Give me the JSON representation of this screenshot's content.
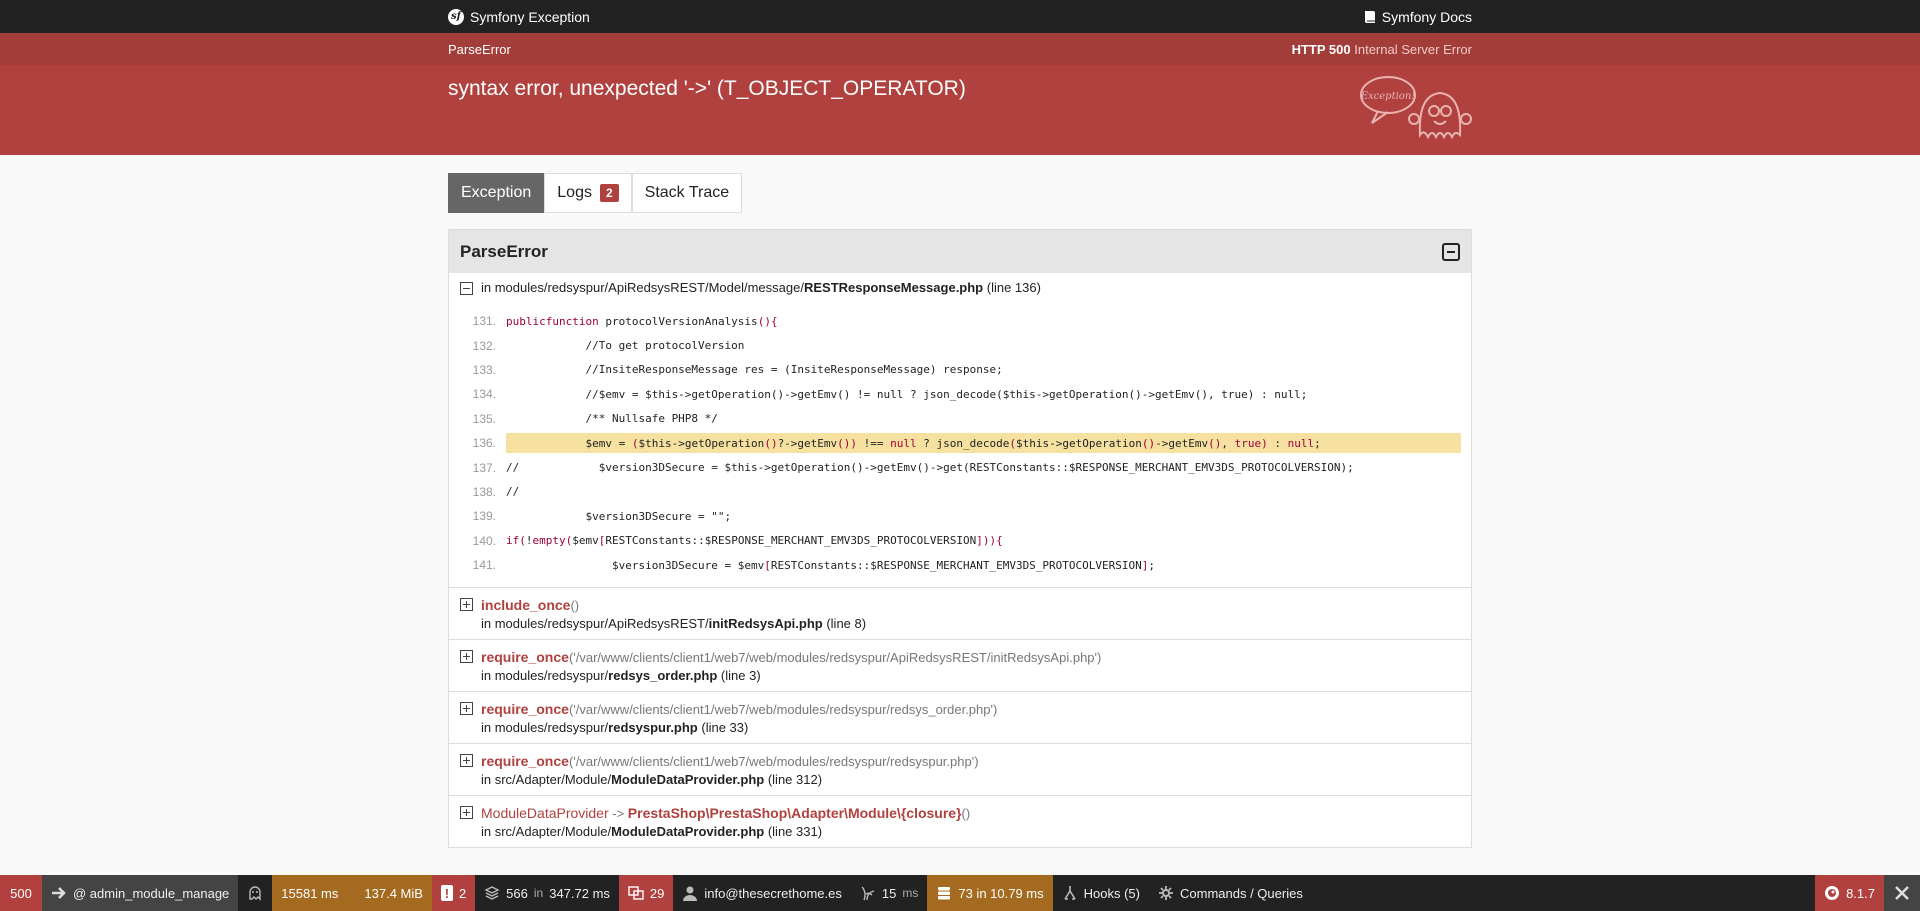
{
  "topbar": {
    "title": "Symfony Exception",
    "docs_label": "Symfony Docs"
  },
  "exception": {
    "class": "ParseError",
    "status_code": "HTTP 500",
    "status_text": "Internal Server Error",
    "message": "syntax error, unexpected '->' (T_OBJECT_OPERATOR)",
    "ghost_text": "Exception!"
  },
  "tabs": {
    "exception": "Exception",
    "logs": "Logs",
    "logs_count": "2",
    "stack_trace": "Stack Trace"
  },
  "panel": {
    "title": "ParseError",
    "location_prefix": "in modules/redsyspur/ApiRedsysREST/Model/message/",
    "location_file": "RESTResponseMessage.php",
    "location_line": "(line 136)"
  },
  "code": [
    {
      "ln": "131.",
      "text": "        public function protocolVersionAnalysis() {"
    },
    {
      "ln": "132.",
      "text": "            //To get protocolVersion"
    },
    {
      "ln": "133.",
      "text": "            //InsiteResponseMessage res = (InsiteResponseMessage) response;"
    },
    {
      "ln": "134.",
      "text": "            //$emv = $this->getOperation()->getEmv() != null ? json_decode($this->getOperation()->getEmv(), true) : null;"
    },
    {
      "ln": "135.",
      "text": "            /** Nullsafe PHP8 */"
    },
    {
      "ln": "136.",
      "text": "            $emv = ($this->getOperation()?->getEmv()) !== null ? json_decode($this->getOperation()->getEmv(), true) : null;"
    },
    {
      "ln": "137.",
      "text": "//            $version3DSecure = $this->getOperation()->getEmv()->get(RESTConstants::$RESPONSE_MERCHANT_EMV3DS_PROTOCOLVERSION);"
    },
    {
      "ln": "138.",
      "text": "//"
    },
    {
      "ln": "139.",
      "text": "            $version3DSecure = \"\";"
    },
    {
      "ln": "140.",
      "text": "            if (!empty($emv[RESTConstants::$RESPONSE_MERCHANT_EMV3DS_PROTOCOLVERSION])) {"
    },
    {
      "ln": "141.",
      "text": "                $version3DSecure = $emv[RESTConstants::$RESPONSE_MERCHANT_EMV3DS_PROTOCOLVERSION];"
    }
  ],
  "traces": [
    {
      "cls": "",
      "fn": "include_once",
      "args": "()",
      "prefix": "in modules/redsyspur/ApiRedsysREST/",
      "file": "initRedsysApi.php",
      "line": "(line 8)"
    },
    {
      "cls": "",
      "fn": "require_once",
      "args": "('/var/www/clients/client1/web7/web/modules/redsyspur/ApiRedsysREST/initRedsysApi.php')",
      "prefix": "in modules/redsyspur/",
      "file": "redsys_order.php",
      "line": "(line 3)"
    },
    {
      "cls": "",
      "fn": "require_once",
      "args": "('/var/www/clients/client1/web7/web/modules/redsyspur/redsys_order.php')",
      "prefix": "in modules/redsyspur/",
      "file": "redsyspur.php",
      "line": "(line 33)"
    },
    {
      "cls": "",
      "fn": "require_once",
      "args": "('/var/www/clients/client1/web7/web/modules/redsyspur/redsyspur.php')",
      "prefix": "in src/Adapter/Module/",
      "file": "ModuleDataProvider.php",
      "line": "(line 312)"
    },
    {
      "cls": "ModuleDataProvider",
      "arrow": " -> ",
      "fn": "PrestaShop\\PrestaShop\\Adapter\\Module\\{closure}",
      "args": "()",
      "prefix": "in src/Adapter/Module/",
      "file": "ModuleDataProvider.php",
      "line": "(line 331)"
    }
  ],
  "toolbar": {
    "status": "500",
    "route": "@ admin_module_manage",
    "time": "15581 ms",
    "memory": "137.4 MiB",
    "errors": "2",
    "cache_count": "566",
    "cache_in": "in",
    "cache_time": "347.72 ms",
    "translations": "29",
    "user": "info@thesecrethome.es",
    "twig_time": "15",
    "twig_unit": "ms",
    "db_queries": "73 in 10.79 ms",
    "hooks": "Hooks (5)",
    "commands": "Commands / Queries",
    "version": "8.1.7"
  }
}
